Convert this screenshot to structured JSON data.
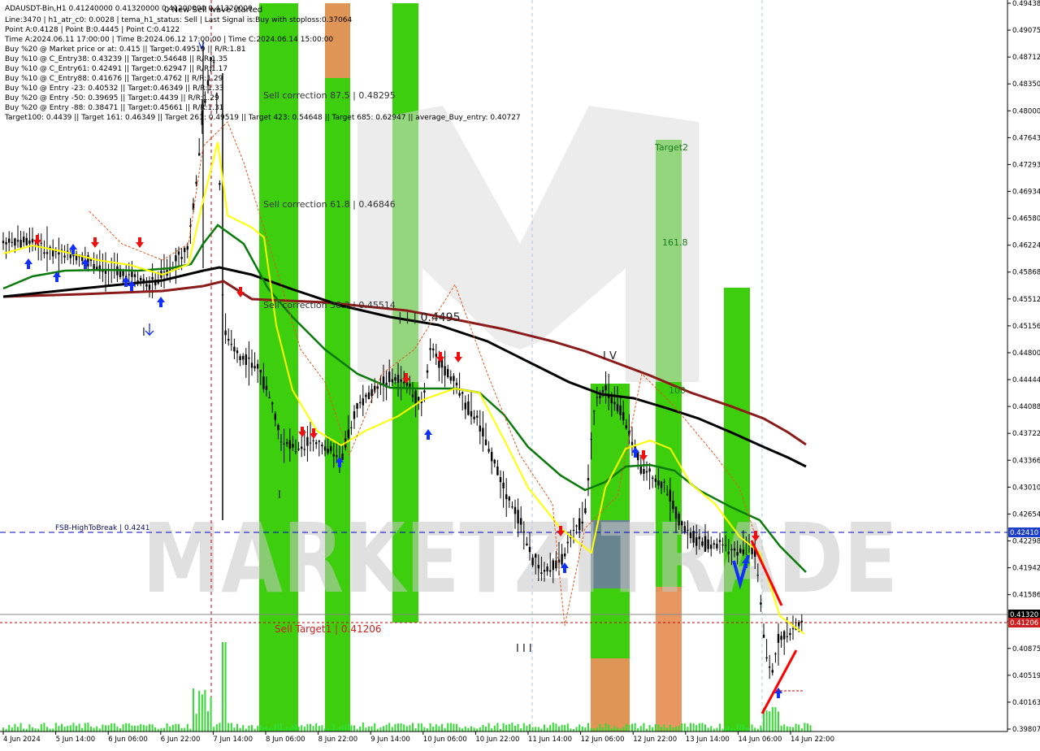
{
  "header": {
    "symbol_line": "ADAUSDT-Bin,H1  0.41240000 0.41320000 0.41200000 0.41320000",
    "new_wave": "0 New Sell wave started",
    "lines": [
      "Line:3470 | h1_atr_c0: 0.0028 | tema_h1_status: Sell | Last Signal is:Buy with stoploss:0.37064",
      "Point A:0.4128 | Point B:0.4445 | Point C:0.4122",
      "Time A:2024.06.11 17:00:00 | Time B:2024.06.12 17:00:00 | Time C:2024.06.14 15:00:00",
      "Buy %20 @ Market price or at: 0.415 || Target:0.49519 || R/R:1.81",
      "Buy %10 @ C_Entry38: 0.43239 || Target:0.54648 || R/R:1.35",
      "Buy %10 @ C_Entry61: 0.42491 || Target:0.62947 || R/R:1.17",
      "Buy %10 @ C_Entry88: 0.41676 || Target:0.4762 || R/R:1.29",
      "Buy %10 @ Entry -23: 0.40532 || Target:0.46349 || R/R:1.33",
      "Buy %20 @ Entry -50: 0.39695 || Target:0.4439 || R/R:1.29",
      "Buy %20 @ Entry -88: 0.38471 || Target:0.45661 || R/R:1.31",
      "Target100: 0.4439 || Target 161: 0.46349 || Target 261: 0.49519 || Target 423: 0.54648 || Target 685: 0.62947 || average_Buy_entry: 0.40727"
    ]
  },
  "annotations": {
    "sell_corr_875": "Sell correction 87.5 | 0.48295",
    "sell_corr_618": "Sell correction 61.8 | 0.46846",
    "sell_corr_382": "Sell correction 38.2 | 0.45514",
    "target2": "Target2",
    "fib_1618": "161.8",
    "fib_100": "100",
    "wave_iii_price": "| | | 0.4495",
    "wave_iv": "I V",
    "wave_i": "I",
    "wave_iii_bottom": "I I I",
    "fsb_label": "FSB-HighToBreak | 0.4241",
    "sell_target": "Sell Target1 | 0.41206",
    "watermark": "MARKETZITRADE"
  },
  "colors": {
    "green_zone": "#33cc00",
    "orange_zone": "#e8915a",
    "slate_zone": "#6a7f96",
    "ma_black": "#000000",
    "ma_darkred": "#8b1a1a",
    "ma_green": "#0a7a0a",
    "ma_yellow": "#ffff00",
    "fsb_line": "#0000cc",
    "target_line": "#cc0000",
    "buy_arrow": "#1030ff",
    "sell_arrow": "#ee1010"
  },
  "price_axis": {
    "ticks": [
      "0.49438",
      "0.49075",
      "0.48712",
      "0.48350",
      "0.48000",
      "0.47643",
      "0.47293",
      "0.46934",
      "0.46580",
      "0.46224",
      "0.45868",
      "0.45512",
      "0.45156",
      "0.44800",
      "0.44444",
      "0.44088",
      "0.43722",
      "0.43366",
      "0.43010",
      "0.42654",
      "0.42298",
      "0.41942",
      "0.41586",
      "0.41230",
      "0.40875",
      "0.40519",
      "0.40163",
      "0.39807"
    ],
    "fsb_badge": "0.42410",
    "price_badge": "0.41320",
    "target_badge": "0.41206"
  },
  "time_axis": {
    "labels": [
      "4 Jun 2024",
      "5 Jun 14:00",
      "6 Jun 06:00",
      "6 Jun 22:00",
      "7 Jun 14:00",
      "8 Jun 06:00",
      "8 Jun 22:00",
      "9 Jun 14:00",
      "10 Jun 06:00",
      "10 Jun 22:00",
      "11 Jun 14:00",
      "12 Jun 06:00",
      "12 Jun 22:00",
      "13 Jun 14:00",
      "14 Jun 06:00",
      "14 Jun 22:00"
    ]
  },
  "chart_data": {
    "type": "candlestick",
    "title": "ADAUSDT-Bin,H1",
    "timeframe": "H1",
    "x_range": [
      "2024-06-04",
      "2024-06-14 22:00"
    ],
    "ylim": [
      0.39807,
      0.49438
    ],
    "last_price": 0.4132,
    "ohlc_last": {
      "open": 0.4124,
      "high": 0.4132,
      "low": 0.412,
      "close": 0.4132
    },
    "points": {
      "A": 0.4128,
      "B": 0.4445,
      "C": 0.4122
    },
    "levels": [
      {
        "name": "FSB-HighToBreak",
        "value": 0.4241
      },
      {
        "name": "Sell Target1",
        "value": 0.41206
      },
      {
        "name": "Sell correction 87.5",
        "value": 0.48295
      },
      {
        "name": "Sell correction 61.8",
        "value": 0.46846
      },
      {
        "name": "Sell correction 38.2",
        "value": 0.45514
      }
    ]
  }
}
